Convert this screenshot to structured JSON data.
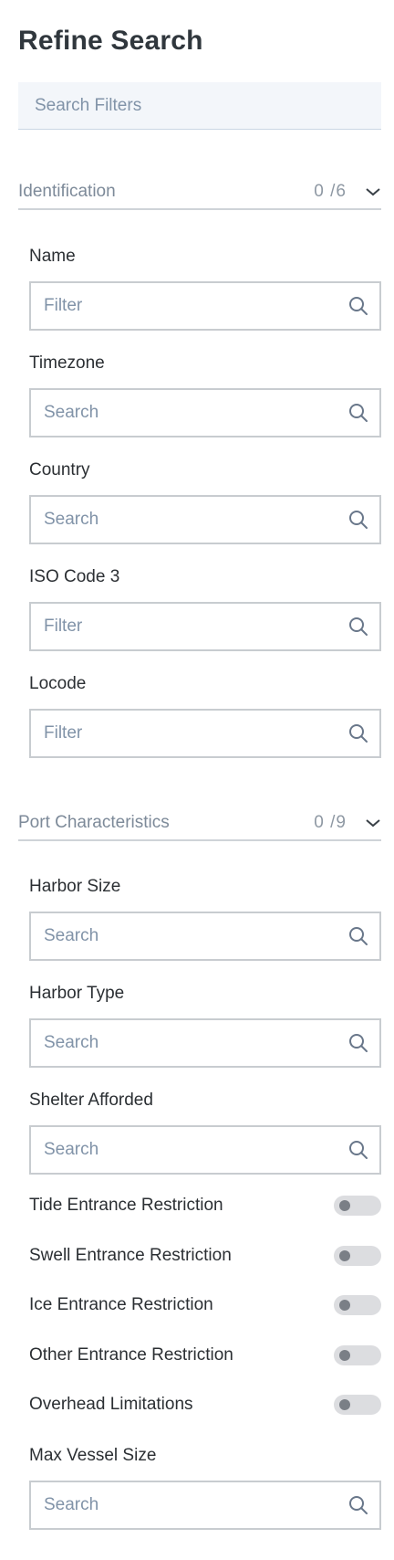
{
  "panel": {
    "title": "Refine Search",
    "search_placeholder": "Search Filters"
  },
  "sections": {
    "identification": {
      "label": "Identification",
      "count": "0 /6",
      "fields": {
        "name": {
          "label": "Name",
          "placeholder": "Filter"
        },
        "timezone": {
          "label": "Timezone",
          "placeholder": "Search"
        },
        "country": {
          "label": "Country",
          "placeholder": "Search"
        },
        "iso3": {
          "label": "ISO Code 3",
          "placeholder": "Filter"
        },
        "locode": {
          "label": "Locode",
          "placeholder": "Filter"
        }
      }
    },
    "port": {
      "label": "Port Characteristics",
      "count": "0 /9",
      "fields": {
        "harbor_size": {
          "label": "Harbor Size",
          "placeholder": "Search"
        },
        "harbor_type": {
          "label": "Harbor Type",
          "placeholder": "Search"
        },
        "shelter": {
          "label": "Shelter Afforded",
          "placeholder": "Search"
        },
        "max_vessel": {
          "label": "Max Vessel Size",
          "placeholder": "Search"
        }
      },
      "toggles": {
        "tide": {
          "label": "Tide Entrance Restriction",
          "on": false
        },
        "swell": {
          "label": "Swell Entrance Restriction",
          "on": false
        },
        "ice": {
          "label": "Ice Entrance Restriction",
          "on": false
        },
        "other": {
          "label": "Other Entrance Restriction",
          "on": false
        },
        "overhead": {
          "label": "Overhead Limitations",
          "on": false
        }
      }
    }
  },
  "icons": {
    "collapse": "chevron-down-icon",
    "field": "search-icon"
  },
  "colors": {
    "title": "#30373d",
    "placeholder": "#8193a8",
    "section_label": "#7d8a99",
    "toggle_track": "#dcdde0",
    "toggle_knob": "#7a7f86"
  }
}
